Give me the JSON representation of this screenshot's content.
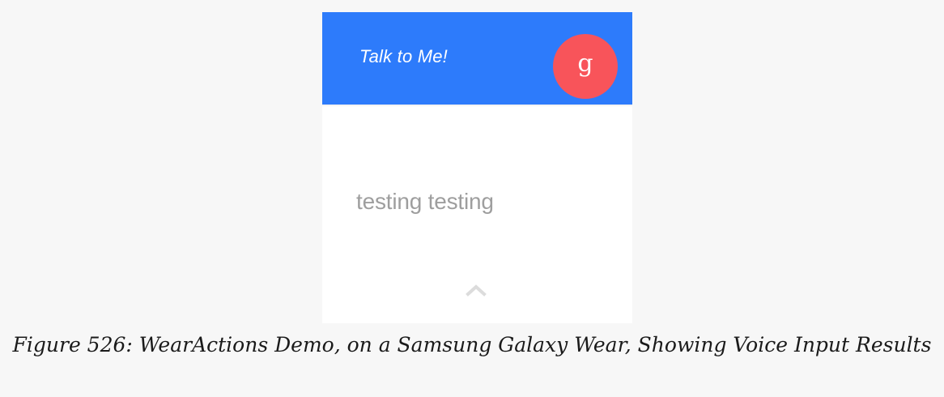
{
  "app": {
    "title": "Talk to Me!",
    "action_icon_letter": "g",
    "action_icon_name": "google-voice-icon",
    "result_text": "testing testing",
    "chevron_icon_name": "chevron-up-icon"
  },
  "figure": {
    "caption": "Figure 526: WearActions Demo, on a Samsung Galaxy Wear, Showing Voice Input Results"
  },
  "colors": {
    "header_bg": "#2d7bfb",
    "action_button_bg": "#f8545a",
    "result_text": "#9e9e9e",
    "page_bg": "#f7f7f7"
  }
}
